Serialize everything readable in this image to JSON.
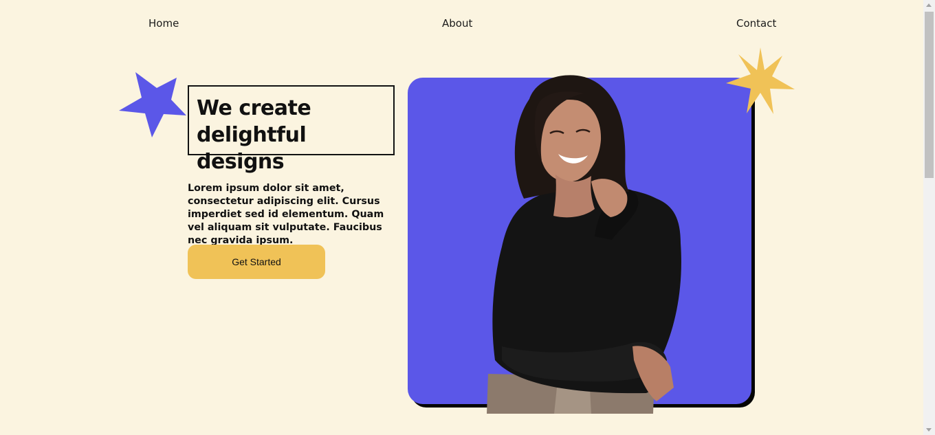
{
  "nav": {
    "home": "Home",
    "about": "About",
    "contact": "Contact"
  },
  "hero": {
    "headline": "We create delightful designs",
    "description": "Lorem ipsum dolor sit amet, consectetur adipiscing elit. Cursus imperdiet sed id elementum. Quam vel aliquam sit vulputate. Faucibus nec gravida ipsum.",
    "cta_label": "Get Started"
  },
  "icons": {
    "left_star": "star-icon",
    "right_star": "sparkle-icon"
  },
  "colors": {
    "background": "#fbf4e0",
    "accent_blue": "#5b57e8",
    "accent_yellow": "#f0c257",
    "text": "#111111"
  }
}
